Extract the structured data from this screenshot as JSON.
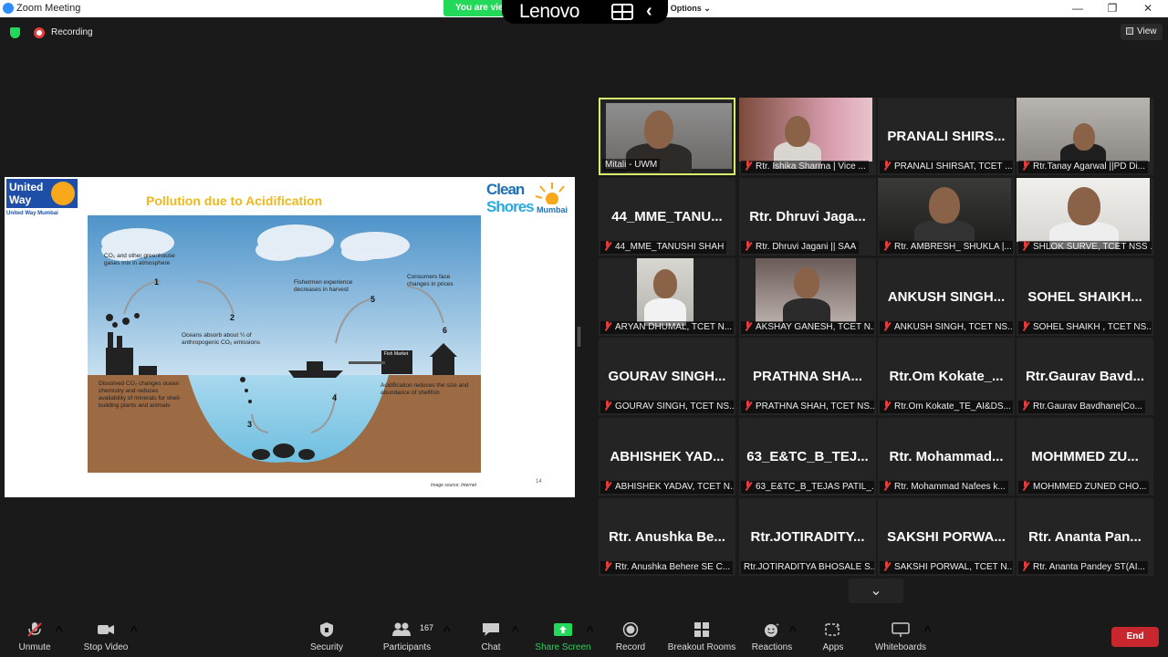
{
  "window": {
    "title": "Zoom Meeting",
    "minimize": "—",
    "maximize": "❐",
    "close": "✕"
  },
  "banner": {
    "viewing_text": "You are vie",
    "view_options_label": "w Options ⌄"
  },
  "lenovo": {
    "brand": "Lenovo"
  },
  "recording": {
    "label": "Recording"
  },
  "view_button": {
    "label": "View"
  },
  "slide": {
    "org_logo": "United Way",
    "org_sub": "United Way Mumbai",
    "title": "Pollution due to Acidification",
    "brand1": "Clean",
    "brand2": "Shores",
    "brand3": "Mumbai",
    "labels": {
      "co2_mix": "CO₂ and other greenhouse gases mix in atmosphere",
      "fishermen": "Fishermen experience decreases in harvest",
      "consumers": "Consumers face changes in prices",
      "oceans_absorb": "Oceans absorb about ¼ of anthropogenic CO₂ emissions",
      "dissolved": "Dissolved CO₂ changes ocean chemistry and reduces availability of minerals for shell-building plants and animals",
      "acidification": "Acidification reduces the size and abundance of shellfish",
      "fish_market": "Fish Market"
    },
    "steps": [
      "1",
      "2",
      "3",
      "4",
      "5",
      "6"
    ],
    "credit": "Image source: Internet",
    "page_number": "14"
  },
  "participants": [
    {
      "big": "",
      "caption": "Mitali - UWM",
      "muted": false,
      "active": true,
      "video": "mitali"
    },
    {
      "big": "",
      "caption": "Rtr. Ishika Sharma | Vice ...",
      "muted": true,
      "video": "ishika"
    },
    {
      "big": "PRANALI SHIRS...",
      "caption": "PRANALI SHIRSAT, TCET ...",
      "muted": true
    },
    {
      "big": "",
      "caption": "Rtr.Tanay Agarwal ||PD Di...",
      "muted": true,
      "video": "tanay"
    },
    {
      "big": "44_MME_TANU...",
      "caption": "44_MME_TANUSHI SHAH",
      "muted": true
    },
    {
      "big": "Rtr. Dhruvi Jaga...",
      "caption": "Rtr. Dhruvi Jagani || SAA",
      "muted": true
    },
    {
      "big": "",
      "caption": "Rtr. AMBRESH_ SHUKLA |...",
      "muted": true,
      "video": "ambresh"
    },
    {
      "big": "",
      "caption": "SHLOK SURVE, TCET NSS ...",
      "muted": true,
      "video": "shlok"
    },
    {
      "big": "",
      "caption": "ARYAN DHUMAL, TCET N...",
      "muted": true,
      "video": "aryan"
    },
    {
      "big": "",
      "caption": "AKSHAY GANESH, TCET N...",
      "muted": true,
      "video": "akshay"
    },
    {
      "big": "ANKUSH SINGH...",
      "caption": "ANKUSH SINGH, TCET NS...",
      "muted": true
    },
    {
      "big": "SOHEL SHAIKH...",
      "caption": "SOHEL SHAIKH , TCET NS...",
      "muted": true
    },
    {
      "big": "GOURAV SINGH...",
      "caption": "GOURAV SINGH, TCET NS...",
      "muted": true
    },
    {
      "big": "PRATHNA SHA...",
      "caption": "PRATHNA SHAH, TCET NS...",
      "muted": true
    },
    {
      "big": "Rtr.Om Kokate_...",
      "caption": "Rtr.Om Kokate_TE_AI&DS...",
      "muted": true
    },
    {
      "big": "Rtr.Gaurav Bavd...",
      "caption": "Rtr.Gaurav Bavdhane|Co...",
      "muted": true
    },
    {
      "big": "ABHISHEK YAD...",
      "caption": "ABHISHEK YADAV, TCET N...",
      "muted": true
    },
    {
      "big": "63_E&TC_B_TEJ...",
      "caption": "63_E&TC_B_TEJAS PATIL_...",
      "muted": true
    },
    {
      "big": "Rtr. Mohammad...",
      "caption": "Rtr. Mohammad Nafees k...",
      "muted": true
    },
    {
      "big": "MOHMMED ZU...",
      "caption": "MOHMMED ZUNED CHO...",
      "muted": true
    },
    {
      "big": "Rtr. Anushka Be...",
      "caption": "Rtr. Anushka Behere SE C...",
      "muted": true
    },
    {
      "big": "Rtr.JOTIRADITY...",
      "caption": "Rtr.JOTIRADITYA BHOSALE S...",
      "muted": false
    },
    {
      "big": "SAKSHI PORWA...",
      "caption": "SAKSHI PORWAL, TCET N...",
      "muted": true
    },
    {
      "big": "Rtr. Ananta Pan...",
      "caption": "Rtr. Ananta Pandey ST(AI...",
      "muted": true
    }
  ],
  "gallery": {
    "scroll_down": "⌄"
  },
  "toolbar": {
    "unmute": "Unmute",
    "stop_video": "Stop Video",
    "security": "Security",
    "participants": "Participants",
    "participant_count": "167",
    "chat": "Chat",
    "share_screen": "Share Screen",
    "record": "Record",
    "breakout_rooms": "Breakout Rooms",
    "reactions": "Reactions",
    "apps": "Apps",
    "whiteboards": "Whiteboards",
    "end": "End",
    "caret": "^"
  },
  "colors": {
    "active_speaker": "#d8f06a",
    "share_green": "#23d959",
    "end_red": "#c8282d",
    "muted_red": "#e23c3c"
  }
}
